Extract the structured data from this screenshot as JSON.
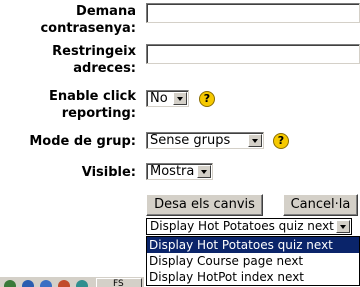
{
  "form": {
    "password_label": "Demana contrasenya:",
    "restrict_label": "Restringeix adreces:",
    "click_reporting_label": "Enable click reporting:",
    "click_reporting_value": "No",
    "group_mode_label": "Mode de grup:",
    "group_mode_value": "Sense grups",
    "visible_label": "Visible:",
    "visible_value": "Mostra",
    "help_glyph": "?"
  },
  "buttons": {
    "save_label": "Desa els canvis",
    "cancel_label": "Cancel·la"
  },
  "after_save": {
    "selected_value": "Display Hot Potatoes quiz next",
    "options": [
      "Display Hot Potatoes quiz next",
      "Display Course page next",
      "Display HotPot index next"
    ]
  },
  "taskbar": {
    "app_fragment": "FS"
  },
  "colors": {
    "selection": "#0a246a",
    "help_icon": "#f6c900",
    "button_face": "#d4d0c8"
  }
}
